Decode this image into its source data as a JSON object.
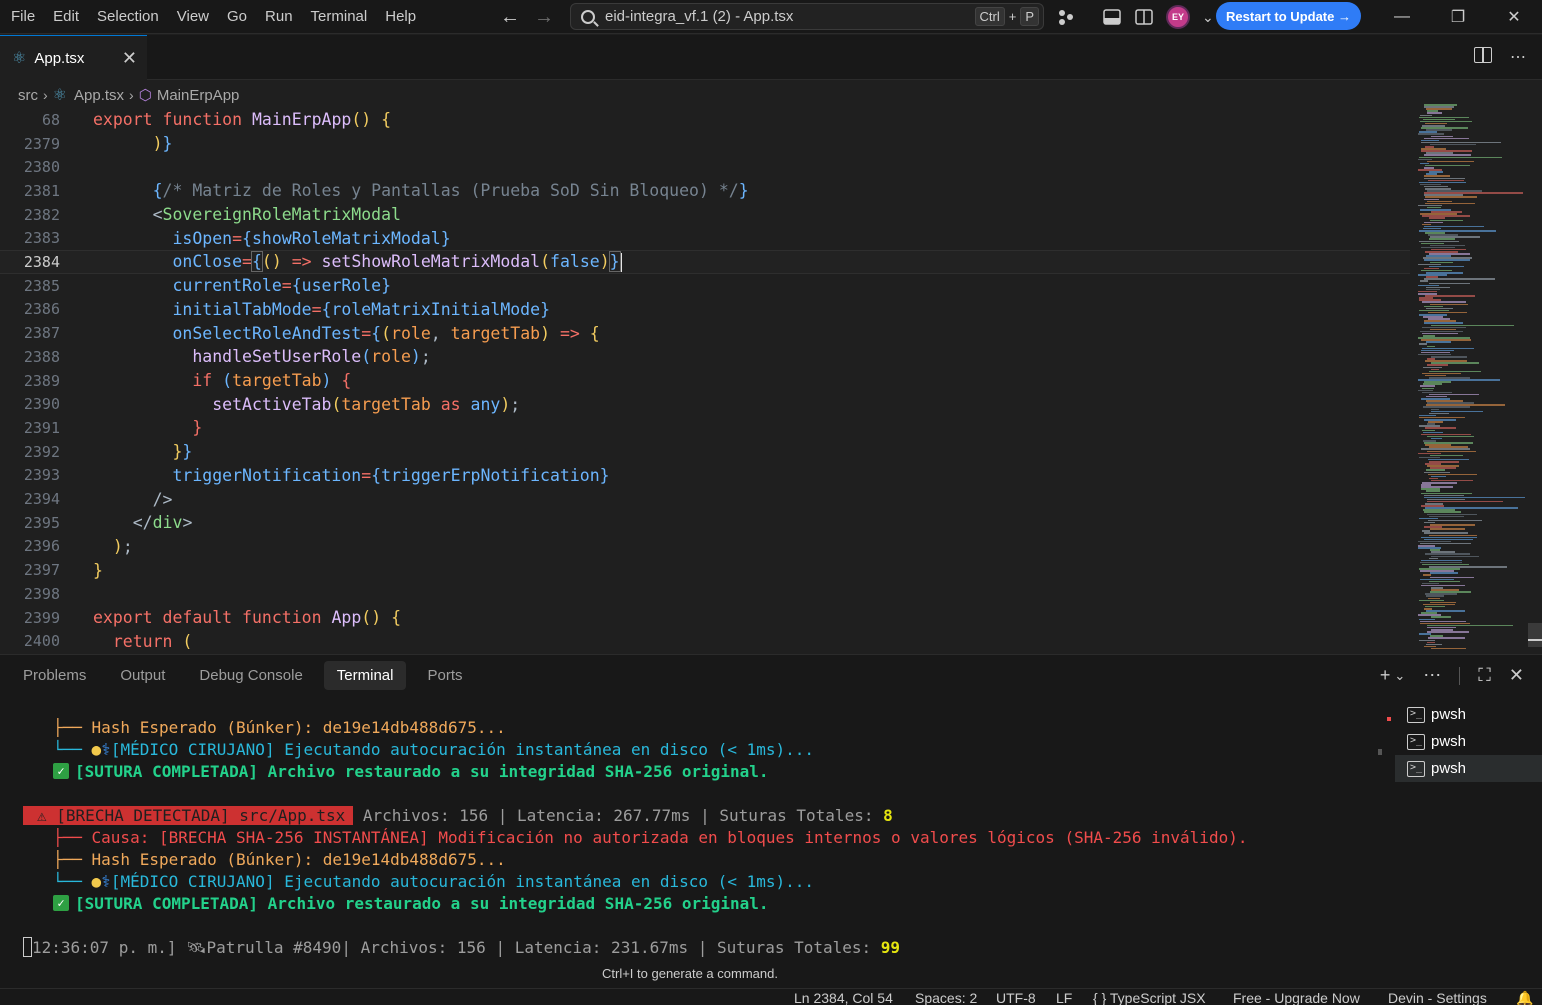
{
  "titlebar": {
    "menu": [
      "File",
      "Edit",
      "Selection",
      "View",
      "Go",
      "Run",
      "Terminal",
      "Help"
    ],
    "search_text": "eid-integra_vf.1 (2) - App.tsx",
    "kbd_ctrl": "Ctrl",
    "kbd_plus": "+",
    "kbd_p": "P",
    "avatar": "EY",
    "restart_label": "Restart to Update →"
  },
  "tab": {
    "label": "App.tsx"
  },
  "breadcrumb": {
    "folder": "src",
    "file": "App.tsx",
    "symbol": "MainErpApp"
  },
  "editor": {
    "current_line": "2384",
    "lines": [
      {
        "n": "68"
      },
      {
        "n": "2379"
      },
      {
        "n": "2380"
      },
      {
        "n": "2381"
      },
      {
        "n": "2382"
      },
      {
        "n": "2383"
      },
      {
        "n": "2384"
      },
      {
        "n": "2385"
      },
      {
        "n": "2386"
      },
      {
        "n": "2387"
      },
      {
        "n": "2388"
      },
      {
        "n": "2389"
      },
      {
        "n": "2390"
      },
      {
        "n": "2391"
      },
      {
        "n": "2392"
      },
      {
        "n": "2393"
      },
      {
        "n": "2394"
      },
      {
        "n": "2395"
      },
      {
        "n": "2396"
      },
      {
        "n": "2397"
      },
      {
        "n": "2398"
      },
      {
        "n": "2399"
      },
      {
        "n": "2400"
      }
    ]
  },
  "panel": {
    "tabs": [
      "Problems",
      "Output",
      "Debug Console",
      "Terminal",
      "Ports"
    ],
    "active_tab": "Terminal",
    "terminals": [
      "pwsh",
      "pwsh",
      "pwsh"
    ],
    "hint": "Ctrl+I to generate a command.",
    "out": {
      "hash1": "├── Hash Esperado (Búnker): de19e14db488d675...",
      "medico_prefix": "└── ",
      "medico_text": "[MÉDICO CIRUJANO] Ejecutando autocuración instantánea en disco (< 1ms)...",
      "sutura": "[SUTURA COMPLETADA] Archivo restaurado a su integridad SHA-256 original.",
      "brecha": "[BRECHA DETECTADA] src/App.tsx",
      "brecha_stats_a": " Archivos: 156 ",
      "brecha_stats_b": " Latencia: 267.77ms ",
      "brecha_stats_c": " Suturas Totales: ",
      "brecha_count": "8",
      "causa_prefix": "├── ",
      "causa": "Causa: [BRECHA SHA-256 INSTANTÁNEA] Modificación no autorizada en bloques internos o valores lógicos (SHA-256 inválido).",
      "patrol_time": "12:36:07 p. m.]",
      "patrol_label": "Patrulla #8490",
      "patrol_files": " Archivos: 156 ",
      "patrol_lat": " Latencia: 231.67ms ",
      "patrol_sut": " Suturas Totales: ",
      "patrol_count": "99",
      "sep": "|"
    }
  },
  "statusbar": {
    "position": "Ln 2384, Col 54",
    "spaces": "Spaces: 2",
    "encoding": "UTF-8",
    "eol": "LF",
    "language": "{ }  TypeScript JSX",
    "upgrade": "Free - Upgrade Now",
    "devin": "Devin - Settings"
  }
}
